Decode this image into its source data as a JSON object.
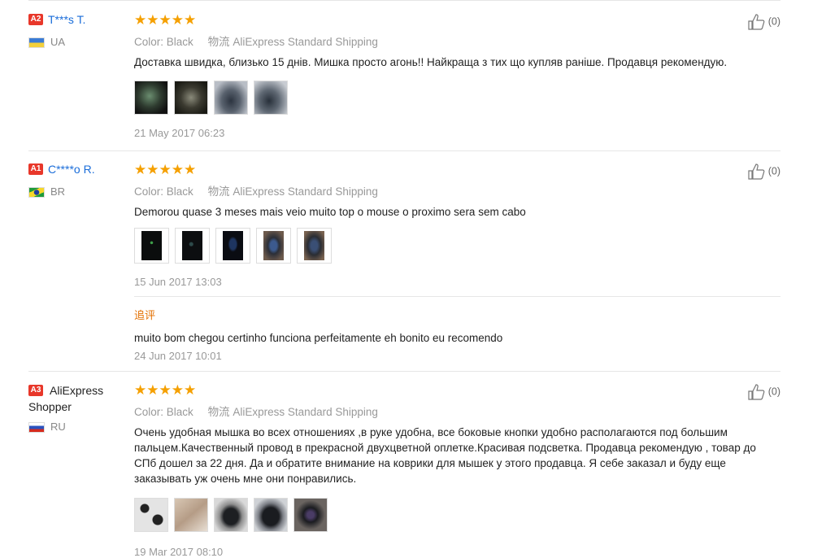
{
  "reviews": [
    {
      "level": "A2",
      "name": "T***s T.",
      "country": "UA",
      "stars": "★★★★★",
      "color_key": "Color:",
      "color_value": "Black",
      "ship_key": "物流",
      "ship_value": "AliExpress Standard Shipping",
      "text": "Доставка швидка, близько 15 днів. Мишка просто агонь!! Найкраща з тих що купляв раніше. Продавця рекомендую.",
      "date": "21 May 2017 06:23",
      "helpful": "(0)"
    },
    {
      "level": "A1",
      "name": "C****o R.",
      "country": "BR",
      "stars": "★★★★★",
      "color_key": "Color:",
      "color_value": "Black",
      "ship_key": "物流",
      "ship_value": "AliExpress Standard Shipping",
      "text": "Demorou quase 3 meses mais veio muito top o mouse o proximo sera sem cabo",
      "date": "15 Jun 2017 13:03",
      "helpful": "(0)",
      "reply_label": "追评",
      "reply_text": "muito bom chegou certinho funciona perfeitamente eh bonito eu recomendo",
      "reply_date": "24 Jun 2017 10:01"
    },
    {
      "level": "A3",
      "name": "AliExpress Shopper",
      "country": "RU",
      "stars": "★★★★★",
      "color_key": "Color:",
      "color_value": "Black",
      "ship_key": "物流",
      "ship_value": "AliExpress Standard Shipping",
      "text": "Очень удобная мышка во всех отношениях ,в руке удобна, все боковые кнопки удобно располагаются под большим пальцем.Качественный провод в прекрасной двухцветной оплетке.Красивая подсветка. Продавца рекомендую , товар до СПб дошел за 22 дня. Да и обратите внимание на коврики для мышек у этого продавца. Я себе заказал и буду еще заказывать уж очень мне они понравились.",
      "date": "19 Mar 2017 08:10",
      "helpful": "(0)"
    }
  ],
  "colors": {
    "star": "#f5a000",
    "level_badge": "#e8372a",
    "username": "#1a6dd9",
    "reply_label": "#e36f00"
  }
}
